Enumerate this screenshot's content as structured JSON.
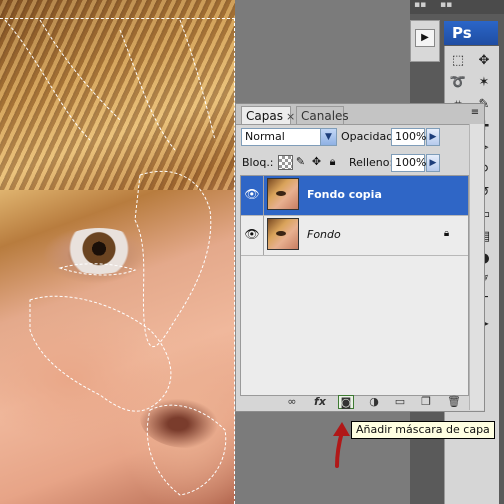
{
  "app": {
    "logo_text": "Ps"
  },
  "layers_panel": {
    "tabs": [
      {
        "label": "Capas",
        "active": true
      },
      {
        "label": "Canales",
        "active": false
      }
    ],
    "tab_close_glyph": "×",
    "blend_mode": "Normal",
    "opacity_label": "Opacidad:",
    "opacity_value": "100%",
    "lock_label": "Bloq.:",
    "fill_label": "Relleno:",
    "fill_value": "100%",
    "layers": [
      {
        "name": "Fondo copia",
        "visible": true,
        "selected": true,
        "locked": false
      },
      {
        "name": "Fondo",
        "visible": true,
        "selected": false,
        "locked": true
      }
    ],
    "bottom_icons": [
      "link-icon",
      "fx-icon",
      "add-mask-icon",
      "adjustment-layer-icon",
      "group-folder-icon",
      "new-layer-icon",
      "trash-icon"
    ],
    "fx_label": "fx"
  },
  "tooltip": {
    "text": "Añadir máscara de capa"
  },
  "colors": {
    "selection_blue": "#2f66c6",
    "ps_logo_blue": "#2b66c8",
    "tooltip_bg": "#ffffe1",
    "arrow_red": "#b01818"
  }
}
